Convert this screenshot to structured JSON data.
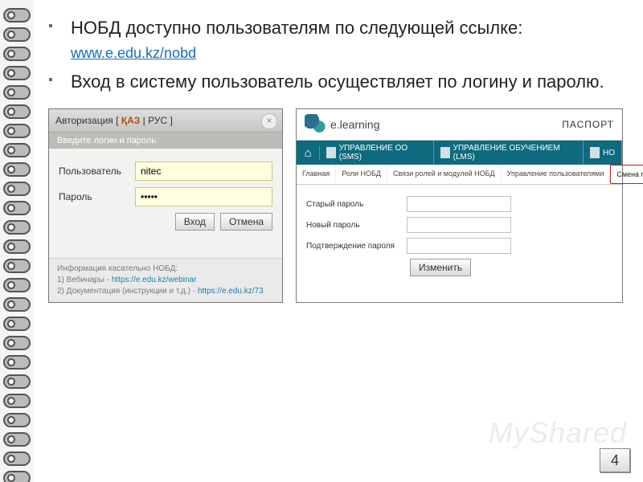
{
  "bullets": {
    "item1_pre": "НОБД  доступно пользователям по следующей ссылке: ",
    "item1_link": "www.e.edu.kz/nobd",
    "item2": "Вход в систему пользователь осуществляет по логину и паролю."
  },
  "login": {
    "title_pre": "Авторизация [ ",
    "title_kaz": "ҚАЗ",
    "title_sep": " | ",
    "title_rus": "РУС",
    "title_post": " ]",
    "strip": "Введите логин и пароль",
    "user_label": "Пользователь",
    "user_value": "nitec",
    "pass_label": "Пароль",
    "pass_value": "•••••",
    "btn_login": "Вход",
    "btn_cancel": "Отмена",
    "info_title": "Информация касательно НОБД:",
    "info_line1": "1) Вебинары - ",
    "info_link1": "https://e.edu.kz/webinar",
    "info_line2": "2) Документация (инструкции и т.д.) - ",
    "info_link2": "https://e.edu.kz/73"
  },
  "el": {
    "brand": "e.learning",
    "passport": "ПАСПОРТ",
    "nav_sms": "УПРАВЛЕНИЕ ОО (SMS)",
    "nav_lms": "УПРАВЛЕНИЕ ОБУЧЕНИЕМ (LMS)",
    "nav_no": "НО",
    "tabs": {
      "main": "Главная",
      "roles": "Роли НОБД",
      "links": "Связи ролей и модулей НОБД",
      "users": "Управление пользователями",
      "pwd": "Смена пароля"
    },
    "old_label": "Старый пароль",
    "new_label": "Новый пароль",
    "conf_label": "Подтверждение пароля",
    "btn_change": "Изменить"
  },
  "watermark": "MyShared",
  "page_num": "4"
}
